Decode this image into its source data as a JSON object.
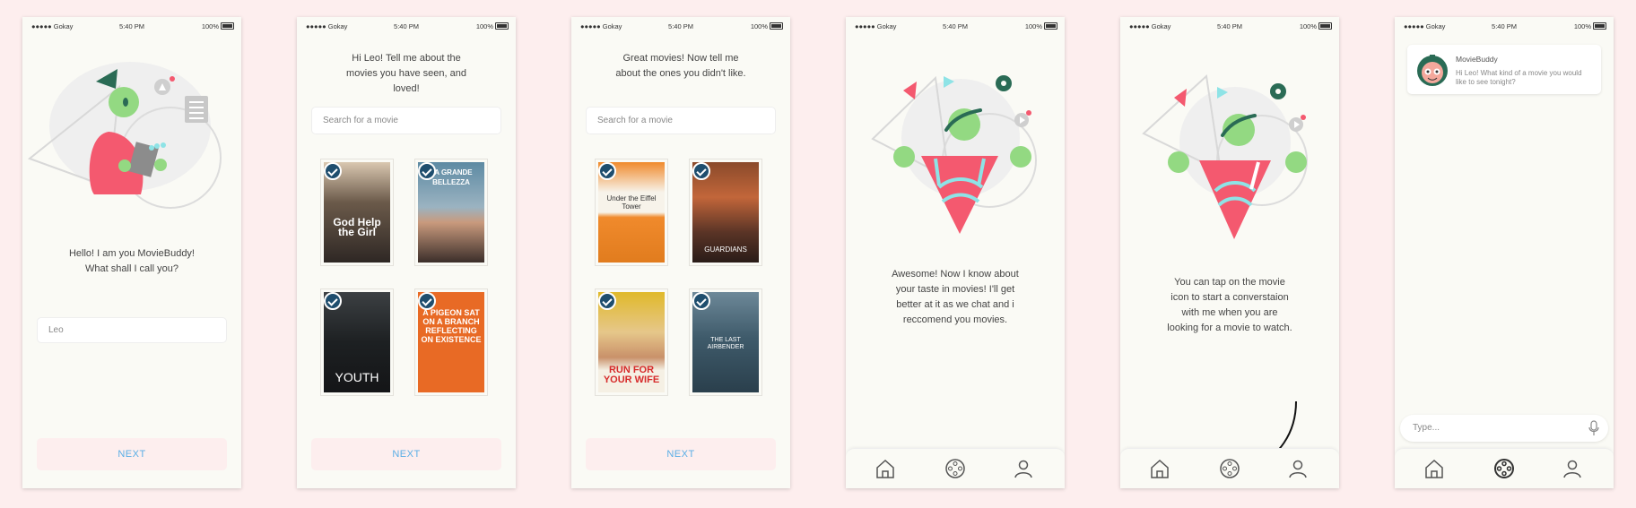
{
  "status": {
    "carrier": "●●●●● Gokay",
    "time": "5:40 PM",
    "battery": "100%"
  },
  "screen1": {
    "greeting_line1": "Hello! I am you MovieBuddy!",
    "greeting_line2": "What shall I call you?",
    "name_value": "Leo",
    "next_label": "NEXT"
  },
  "screen2": {
    "prompt_lines": [
      "Hi Leo! Tell me about the",
      "movies you have seen, and",
      "loved!"
    ],
    "search_placeholder": "Search for a movie",
    "next_label": "NEXT",
    "posters": [
      {
        "title": "God Help the Girl",
        "bg": "#3a3633"
      },
      {
        "title": "LA GRANDE BELLEZZA",
        "bg": "#4f7288"
      },
      {
        "title": "YOUTH",
        "bg": "#1f2224"
      },
      {
        "title": "A PIGEON SAT ON A BRANCH REFLECTING ON EXISTENCE",
        "bg": "#e86a25"
      }
    ]
  },
  "screen3": {
    "prompt_lines": [
      "Great movies! Now tell me",
      "about the ones you didn't like."
    ],
    "search_placeholder": "Search for a movie",
    "next_label": "NEXT",
    "posters": [
      {
        "title": "Under the Eiffel Tower",
        "bg": "#f08a2c"
      },
      {
        "title": "GUARDIANS",
        "bg": "#5a3426"
      },
      {
        "title": "RUN FOR YOUR WIFE",
        "bg": "#e0b92a"
      },
      {
        "title": "THE LAST AIRBENDER",
        "bg": "#3f5b6b"
      }
    ]
  },
  "screen4": {
    "message_lines": [
      "Awesome! Now I know about",
      "your taste in movies! I'll get",
      "better at it as we chat and i",
      "reccomend you movies."
    ]
  },
  "screen5": {
    "message_lines": [
      "You can tap on the movie",
      "icon to start a converstaion",
      "with me when you are",
      "looking for a movie to watch."
    ]
  },
  "screen6": {
    "sender": "MovieBuddy",
    "message": "Hi Leo! What kind of a movie you would like to see tonight?",
    "input_placeholder": "Type..."
  },
  "colors": {
    "accent_pink": "#f4596f",
    "green": "#93d982",
    "dark_green": "#2a6b55",
    "cyan": "#8ee3e6",
    "link_blue": "#5aaee6"
  },
  "icons": [
    "home-icon",
    "film-reel-icon",
    "user-icon",
    "microphone-icon",
    "wifi-icon",
    "battery-icon",
    "checkmark-icon"
  ]
}
